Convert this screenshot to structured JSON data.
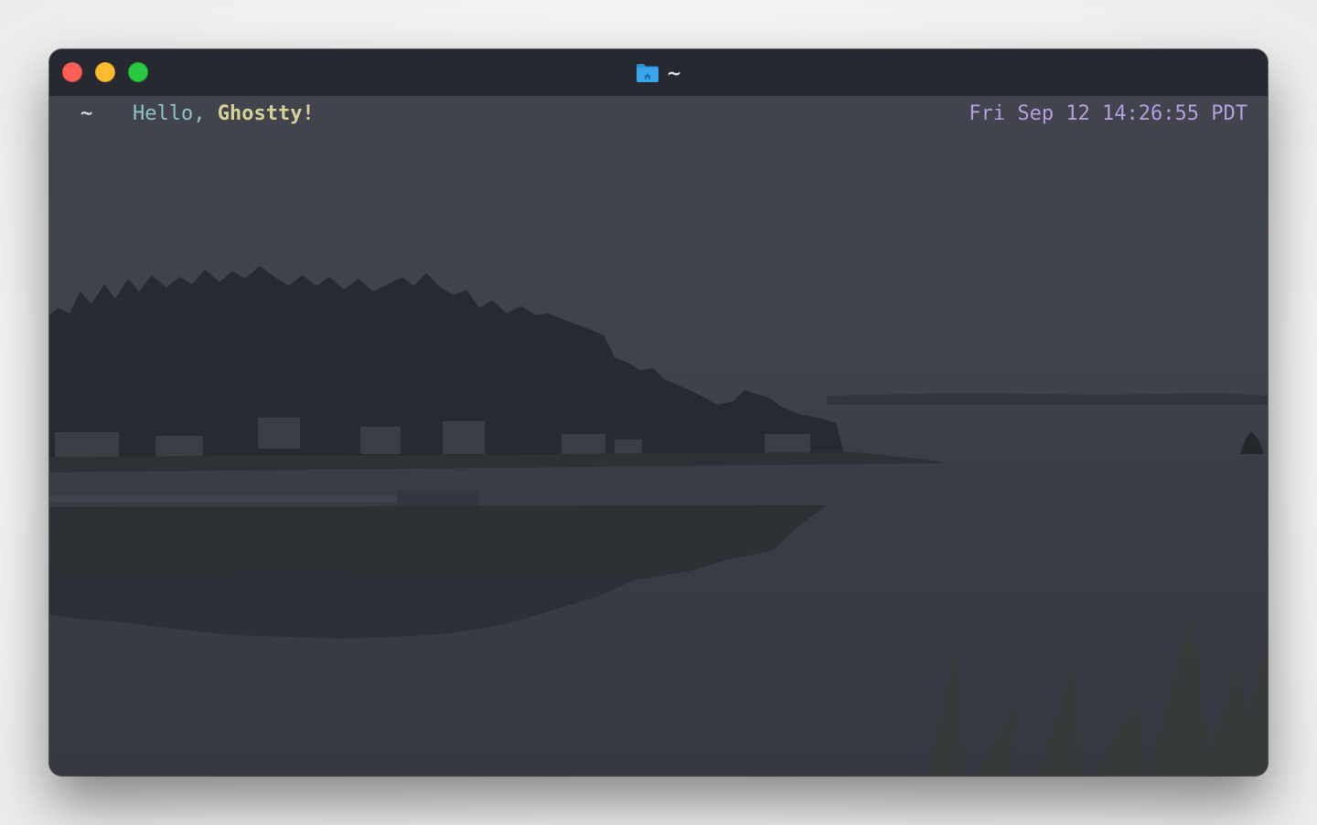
{
  "window": {
    "title": "~",
    "title_icon": "home-folder-icon"
  },
  "traffic_lights": {
    "close_color": "#ff5f57",
    "minimize_color": "#febc2e",
    "maximize_color": "#28c840"
  },
  "terminal": {
    "cwd": "~",
    "greeting_prefix": "Hello, ",
    "greeting_name": "Ghostty!",
    "datetime": "Fri Sep 12 14:26:55 PDT"
  },
  "colors": {
    "titlebar": "#262930",
    "background": "#3a3d45",
    "cwd": "#cfd3dc",
    "greeting_hello": "#8fc3c7",
    "greeting_name": "#d7d197",
    "datetime": "#b69ce0"
  }
}
